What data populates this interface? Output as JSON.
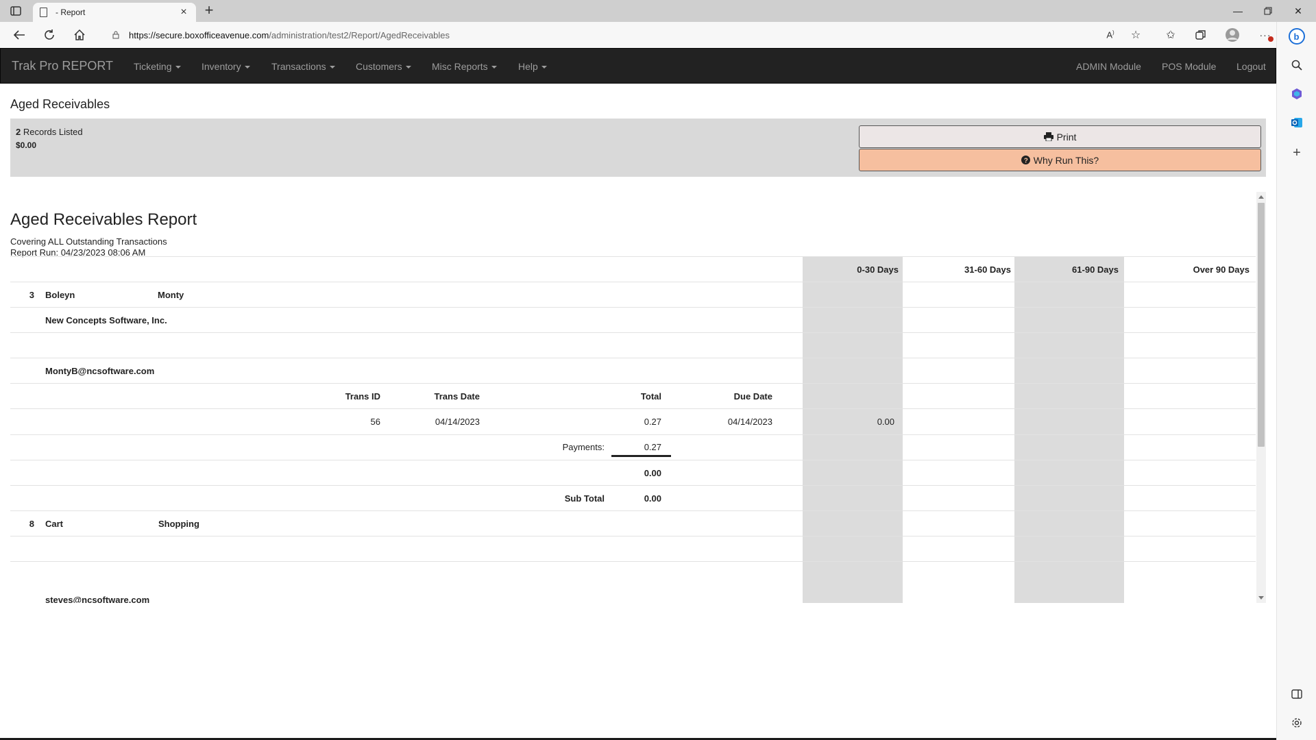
{
  "browser": {
    "tab_title": "- Report",
    "url_domain": "https://secure.boxofficeavenue.com",
    "url_path": "/administration/test2/Report/AgedReceivables"
  },
  "nav": {
    "brand": "Trak Pro REPORT",
    "menus": [
      "Ticketing",
      "Inventory",
      "Transactions",
      "Customers",
      "Misc Reports",
      "Help"
    ],
    "right": [
      "ADMIN Module",
      "POS Module",
      "Logout"
    ]
  },
  "page": {
    "title": "Aged Receivables",
    "records_count": "2",
    "records_label": " Records Listed",
    "total": "$0.00",
    "print_label": "Print",
    "why_label": "Why Run This?"
  },
  "report": {
    "title": "Aged Receivables Report",
    "covering": "Covering ALL Outstanding Transactions",
    "run": "Report Run: 04/23/2023 08:06 AM",
    "aging_headers": [
      "0-30 Days",
      "31-60 Days",
      "61-90 Days",
      "Over 90 Days"
    ],
    "trans_headers": {
      "id": "Trans ID",
      "date": "Trans Date",
      "total": "Total",
      "due": "Due Date"
    },
    "customers": [
      {
        "id": "3",
        "last": "Boleyn",
        "first": "Monty",
        "company": "New Concepts Software, Inc.",
        "email": "MontyB@ncsoftware.com",
        "trans": {
          "id": "56",
          "date": "04/14/2023",
          "total": "0.27",
          "due": "04/14/2023",
          "bucket_0_30": "0.00"
        },
        "payments_label": "Payments:",
        "payments": "0.27",
        "balance": "0.00",
        "subtotal_label": "Sub Total",
        "subtotal": "0.00"
      },
      {
        "id": "8",
        "last": "Cart",
        "first": "Shopping",
        "email": "steves@ncsoftware.com"
      }
    ]
  }
}
